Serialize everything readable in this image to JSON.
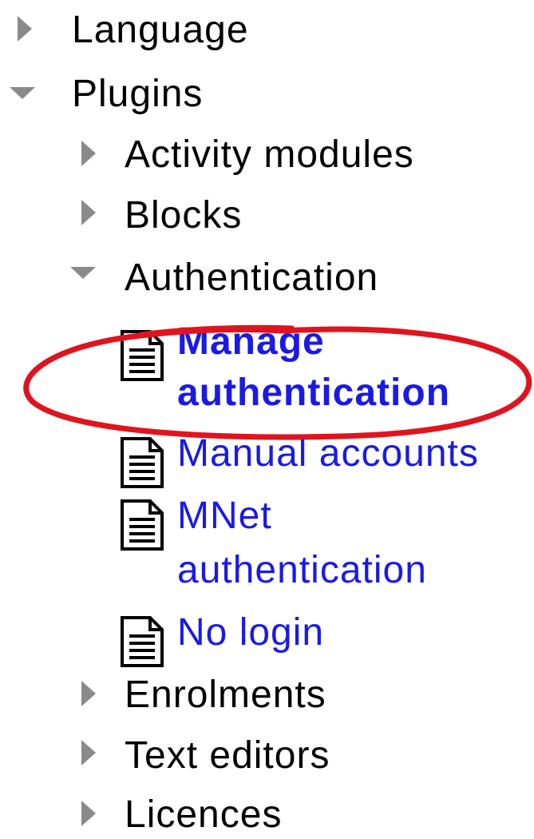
{
  "tree": {
    "language": {
      "label": "Language",
      "state": "collapsed"
    },
    "plugins": {
      "label": "Plugins",
      "state": "expanded",
      "children": {
        "activity_modules": {
          "label": "Activity modules",
          "state": "collapsed"
        },
        "blocks": {
          "label": "Blocks",
          "state": "collapsed"
        },
        "authentication": {
          "label": "Authentication",
          "state": "expanded",
          "pages": {
            "manage_authentication": {
              "line1": "Manage",
              "line2": "authentication",
              "highlighted": true
            },
            "manual_accounts": {
              "label": "Manual accounts"
            },
            "mnet_authentication": {
              "line1": "MNet",
              "line2": "authentication"
            },
            "no_login": {
              "label": "No login"
            }
          }
        },
        "enrolments": {
          "label": "Enrolments",
          "state": "collapsed"
        },
        "text_editors": {
          "label": "Text editors",
          "state": "collapsed"
        },
        "licences": {
          "label": "Licences",
          "state": "collapsed"
        }
      }
    }
  },
  "colors": {
    "link": "#1a1ae6",
    "arrow": "#8a8a8a",
    "highlight_circle": "#e0141e",
    "text": "#000000"
  },
  "icons": {
    "collapsed": "triangle-right-icon",
    "expanded": "triangle-down-icon",
    "page": "document-icon"
  }
}
